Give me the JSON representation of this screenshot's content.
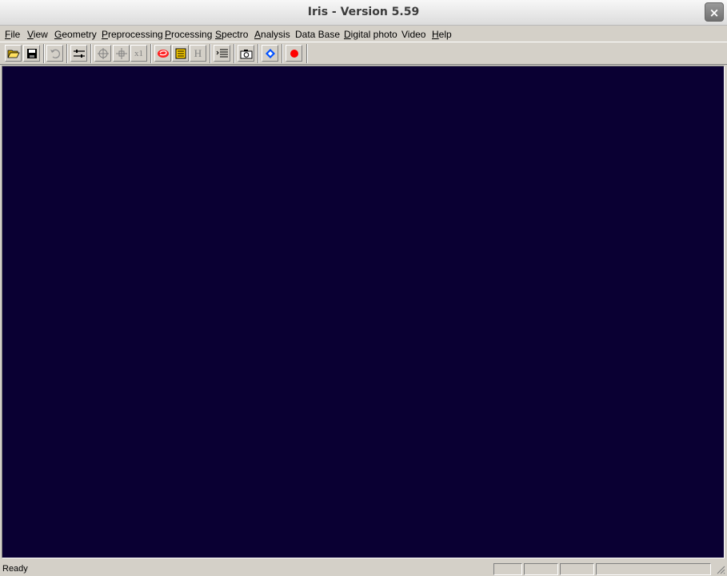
{
  "window": {
    "title": "Iris - Version 5.59",
    "close_label": "×"
  },
  "menu": [
    {
      "mnemonic": "F",
      "rest": "ile"
    },
    {
      "mnemonic": "V",
      "rest": "iew"
    },
    {
      "mnemonic": "G",
      "rest": "eometry"
    },
    {
      "mnemonic": "P",
      "rest": "reprocessing"
    },
    {
      "mnemonic": "P",
      "rest": "rocessing"
    },
    {
      "mnemonic": "S",
      "rest": "pectro"
    },
    {
      "mnemonic": "A",
      "rest": "nalysis"
    },
    {
      "mnemonic": "",
      "rest": "Data Base"
    },
    {
      "mnemonic": "D",
      "rest": "igital photo"
    },
    {
      "mnemonic": "",
      "rest": "Video"
    },
    {
      "mnemonic": "H",
      "rest": "elp"
    }
  ],
  "toolbar": {
    "icons": [
      "open-folder-icon",
      "save-disk-icon",
      "undo-icon",
      "settings-sliders-icon",
      "crosshair-icon",
      "move-crosshair-icon",
      "zoom-x1-icon",
      "red-spiral-icon",
      "yellow-list-icon",
      "h-icon",
      "command-list-icon",
      "camera-icon",
      "blue-diamond-icon",
      "red-record-icon"
    ],
    "zoom_label": "x1",
    "h_label": "H"
  },
  "colors": {
    "canvas": "#0a0033",
    "chrome": "#d4d0c8"
  },
  "status": {
    "text": "Ready"
  }
}
